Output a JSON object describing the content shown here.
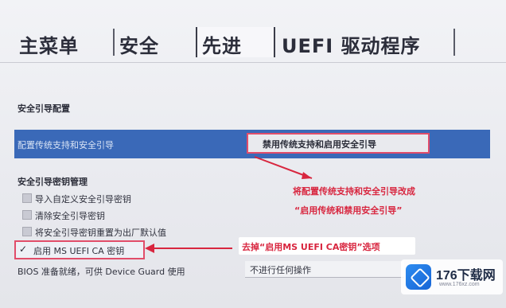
{
  "tabs": [
    "主菜单",
    "安全",
    "先进",
    "UEFI 驱动程序"
  ],
  "section_title": "安全引导配置",
  "selected_row": {
    "label": "配置传统支持和安全引导",
    "value": "禁用传统支持和启用安全引导"
  },
  "key_management": {
    "title": "安全引导密钥管理",
    "items": [
      "导入自定义安全引导密钥",
      "清除安全引导密钥",
      "将安全引导密钥重置为出厂默认值"
    ],
    "checked_item": "启用 MS UEFI CA 密钥",
    "checkmark": "✓"
  },
  "bios_row": {
    "label": "BIOS 准备就绪，可供 Device Guard 使用",
    "value": "不进行任何操作"
  },
  "annotations": {
    "note1_line1": "将配置传统支持和安全引导改成",
    "note1_line2": "“启用传统和禁用安全引导”",
    "note2": "去掉“启用MS UEFI CA密钥”选项"
  },
  "watermark": {
    "name": "176下载网",
    "url": "www.176xz.com"
  },
  "colors": {
    "highlight_row": "#3a69b8",
    "annotation_red": "#d8263f",
    "frame_red": "#e14d6a"
  }
}
